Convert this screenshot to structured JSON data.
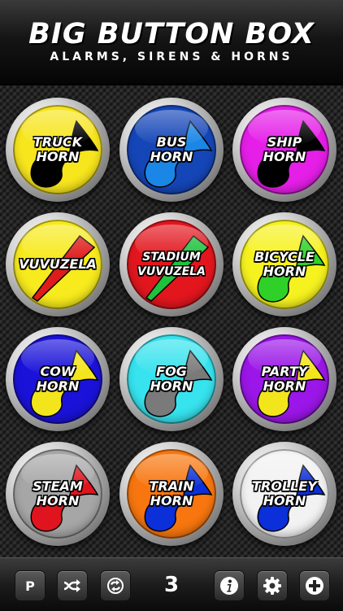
{
  "header": {
    "title": "BIG BUTTON BOX",
    "subtitle": "ALARMS, SIRENS & HORNS"
  },
  "buttons": [
    {
      "line1": "TRUCK",
      "line2": "HORN",
      "color": "#f7e51d",
      "horn_color": "#000000"
    },
    {
      "line1": "BUS",
      "line2": "HORN",
      "color": "#1546b8",
      "horn_color": "#1a86e6"
    },
    {
      "line1": "SHIP",
      "line2": "HORN",
      "color": "#e51ee8",
      "horn_color": "#000000"
    },
    {
      "line1": "VUVUZELA",
      "line2": "",
      "color": "#f7ea1d",
      "horn_color": "#e01b1b"
    },
    {
      "line1": "STADIUM",
      "line2": "VUVUZELA",
      "color": "#e3161e",
      "horn_color": "#1fc23b"
    },
    {
      "line1": "BICYCLE",
      "line2": "HORN",
      "color": "#f6f21f",
      "horn_color": "#2fd128"
    },
    {
      "line1": "COW",
      "line2": "HORN",
      "color": "#1a12d9",
      "horn_color": "#f3e51c"
    },
    {
      "line1": "FOG",
      "line2": "HORN",
      "color": "#36e3ee",
      "horn_color": "#7a7a7a"
    },
    {
      "line1": "PARTY",
      "line2": "HORN",
      "color": "#9b16e8",
      "horn_color": "#f3e51c"
    },
    {
      "line1": "STEAM",
      "line2": "HORN",
      "color": "#a6a6a6",
      "horn_color": "#e0141e"
    },
    {
      "line1": "TRAIN",
      "line2": "HORN",
      "color": "#f7760f",
      "horn_color": "#0b2fd8"
    },
    {
      "line1": "TROLLEY",
      "line2": "HORN",
      "color": "#f2f2f2",
      "horn_color": "#0b2fd8"
    }
  ],
  "toolbar": {
    "p_label": "P",
    "count": "3",
    "icons": [
      "shuffle-icon",
      "repeat-icon",
      "info-icon",
      "gear-icon",
      "plus-icon"
    ]
  }
}
